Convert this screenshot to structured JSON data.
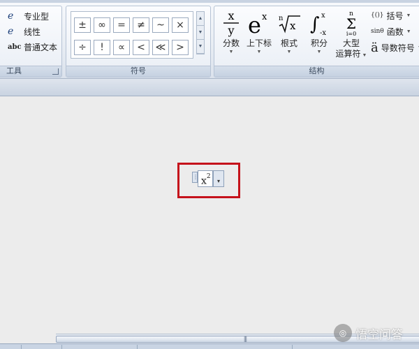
{
  "ribbon": {
    "tools": {
      "label": "工具",
      "items": [
        {
          "icon": "professional-format-icon",
          "glyph": "e",
          "label": "专业型"
        },
        {
          "icon": "linear-format-icon",
          "glyph": "e",
          "label": "线性"
        },
        {
          "icon": "normal-text-icon",
          "glyph": "abc",
          "label": "普通文本"
        }
      ]
    },
    "symbols": {
      "label": "符号",
      "row1": [
        "±",
        "∞",
        "=",
        "≠",
        "~",
        "×"
      ],
      "row2": [
        "÷",
        "!",
        "∝",
        "<",
        "≪",
        ">"
      ],
      "scroll": [
        "▲",
        "▼",
        "▼"
      ]
    },
    "structures": {
      "label": "结构",
      "big": [
        {
          "name": "fraction",
          "label": "分数"
        },
        {
          "name": "script",
          "label": "上下标"
        },
        {
          "name": "radical",
          "label": "根式"
        },
        {
          "name": "integral",
          "label": "积分"
        },
        {
          "name": "large-operator",
          "label": "大型",
          "label2": "运算符"
        }
      ],
      "small": [
        {
          "name": "bracket",
          "icon_text": "{()}",
          "label": "括号"
        },
        {
          "name": "function",
          "icon_text": "sinθ",
          "label": "函数"
        },
        {
          "name": "accent",
          "icon_text": "ä",
          "label": "导数符号"
        }
      ]
    }
  },
  "equation": {
    "base": "x",
    "superscript": "2",
    "handle": "⋮",
    "dropdown": "▾"
  },
  "scrollbar": {
    "grip": "|||"
  },
  "watermark": {
    "text": "悟空问答"
  },
  "colors": {
    "highlight": "#c5121b",
    "ribbon_border": "#b6c3d5"
  }
}
